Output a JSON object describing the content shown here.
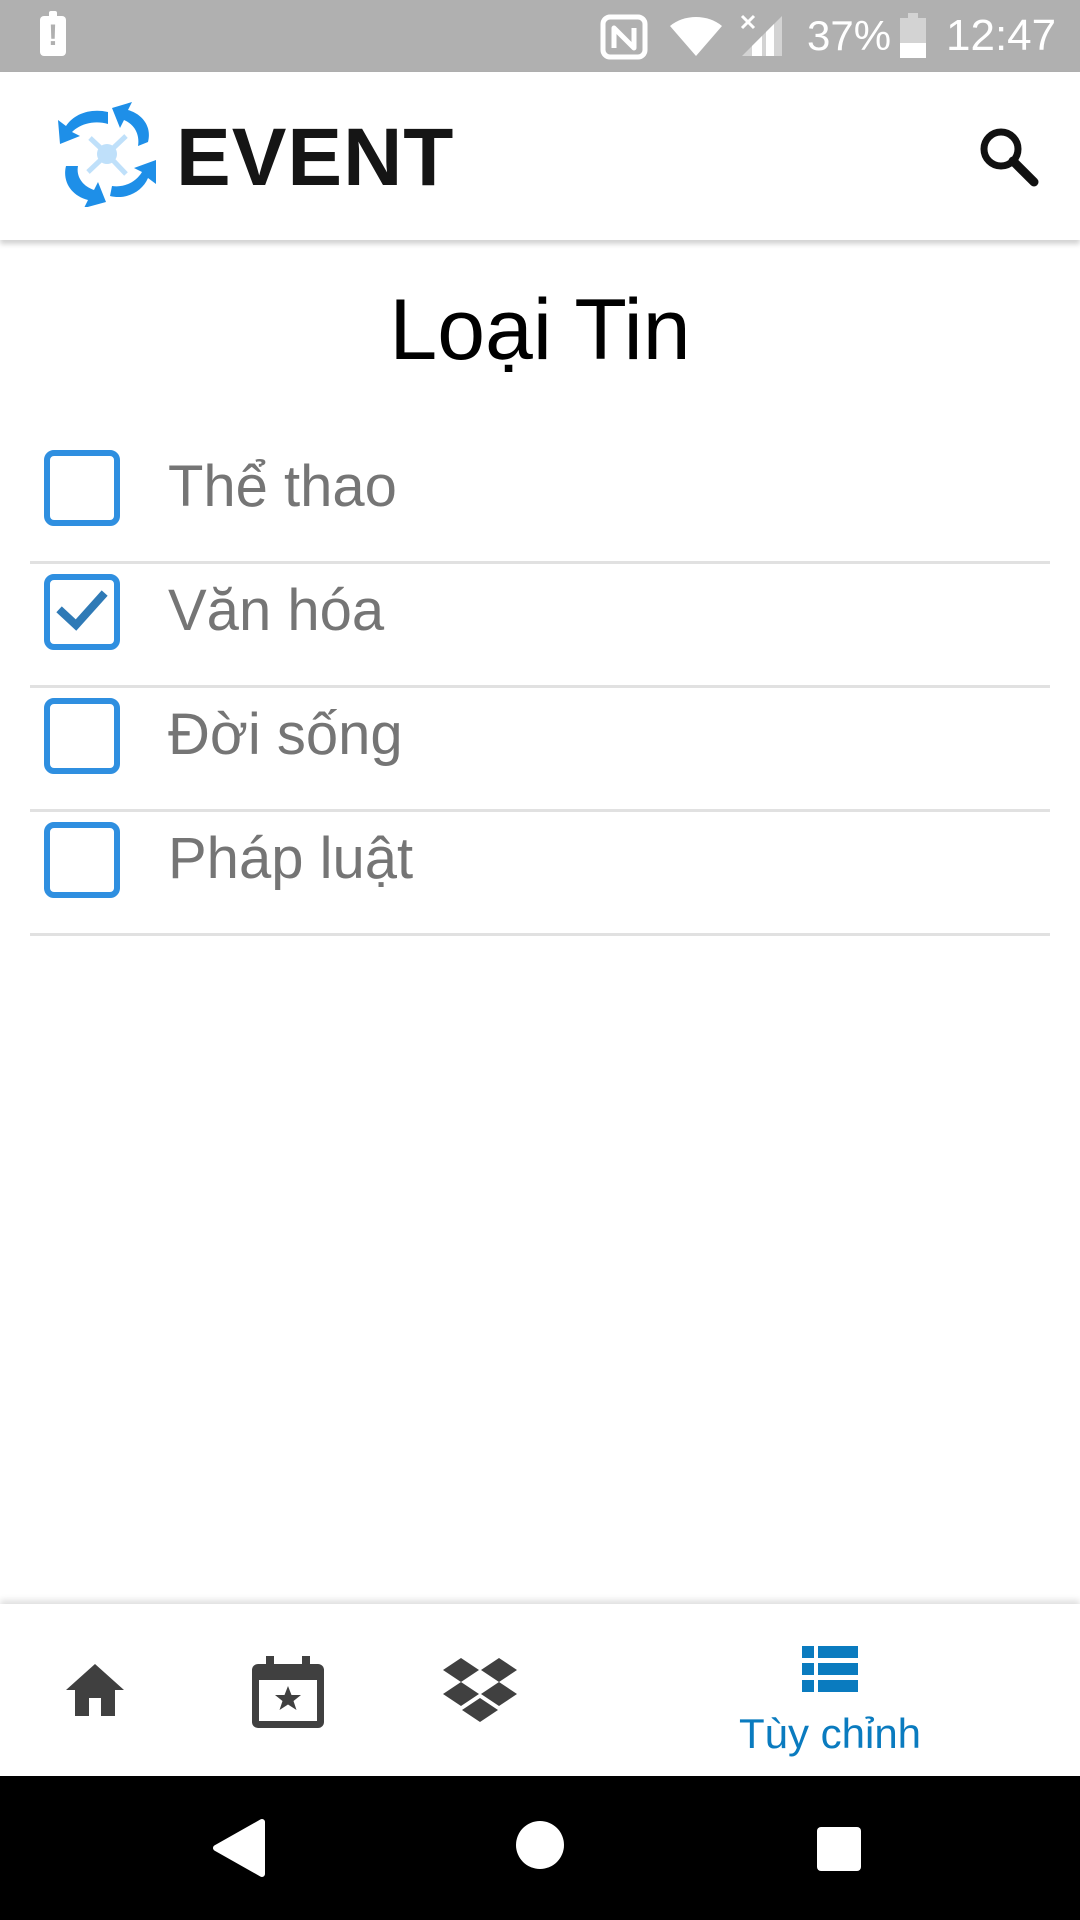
{
  "status_bar": {
    "battery_percent": "37%",
    "time": "12:47"
  },
  "app_bar": {
    "logo_text": "EVENT"
  },
  "page": {
    "title": "Loại Tin"
  },
  "options": [
    {
      "label": "Thể thao",
      "checked": false
    },
    {
      "label": "Văn hóa",
      "checked": true
    },
    {
      "label": "Đời sống",
      "checked": false
    },
    {
      "label": "Pháp luật",
      "checked": false
    }
  ],
  "bottom_nav": {
    "items": [
      {
        "icon": "home-icon",
        "active": false
      },
      {
        "icon": "calendar-star-icon",
        "active": false
      },
      {
        "icon": "dropbox-icon",
        "active": false
      },
      {
        "icon": "list-icon",
        "label": "Tùy chỉnh",
        "active": true
      }
    ]
  },
  "colors": {
    "accent": "#2f8fe0",
    "active_tab": "#0a7bbf",
    "status_bar": "#b0b0b0"
  }
}
